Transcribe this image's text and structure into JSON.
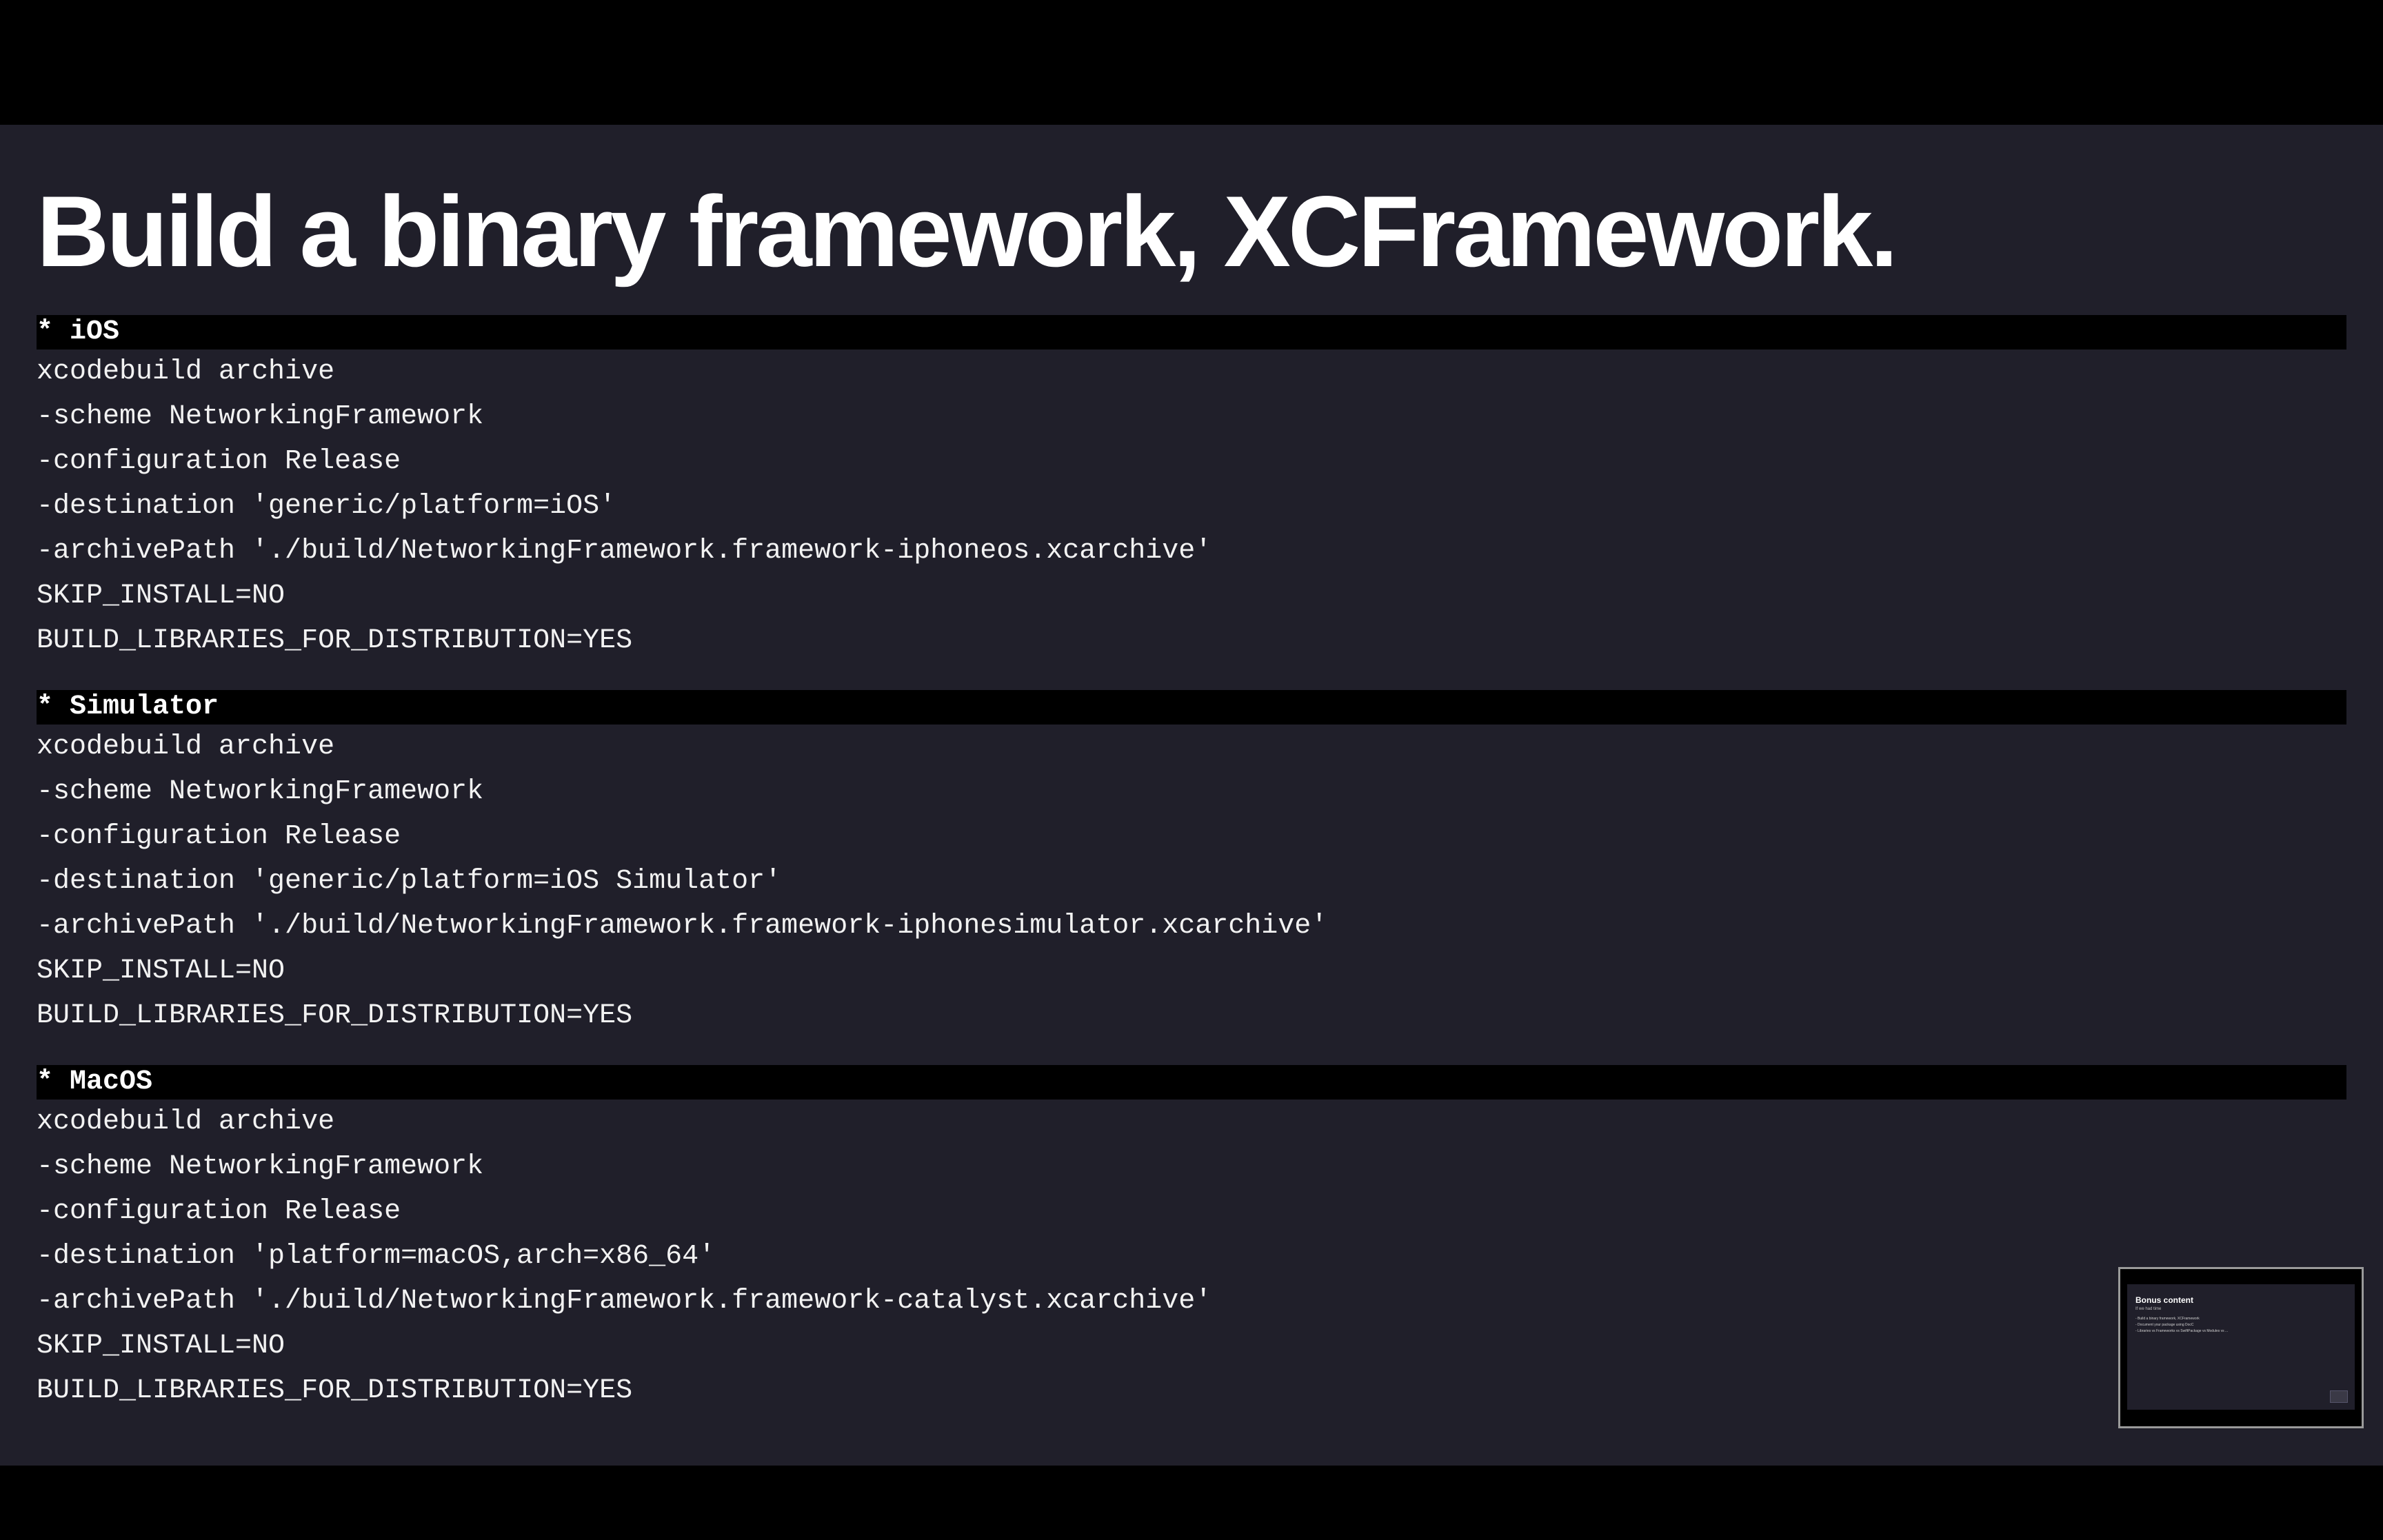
{
  "slide": {
    "title": "Build a binary framework, XCFramework.",
    "sections": [
      {
        "header": "* iOS",
        "lines": [
          "xcodebuild archive",
          "-scheme NetworkingFramework",
          "-configuration Release",
          "-destination 'generic/platform=iOS'",
          "-archivePath './build/NetworkingFramework.framework-iphoneos.xcarchive'",
          "SKIP_INSTALL=NO",
          "BUILD_LIBRARIES_FOR_DISTRIBUTION=YES"
        ]
      },
      {
        "header": "* Simulator",
        "lines": [
          "xcodebuild archive",
          "-scheme NetworkingFramework",
          "-configuration Release",
          "-destination 'generic/platform=iOS Simulator'",
          "-archivePath './build/NetworkingFramework.framework-iphonesimulator.xcarchive'",
          "SKIP_INSTALL=NO",
          "BUILD_LIBRARIES_FOR_DISTRIBUTION=YES"
        ]
      },
      {
        "header": "* MacOS",
        "lines": [
          "xcodebuild archive",
          "-scheme NetworkingFramework",
          "-configuration Release",
          "-destination 'platform=macOS,arch=x86_64'",
          "-archivePath './build/NetworkingFramework.framework-catalyst.xcarchive'",
          "SKIP_INSTALL=NO",
          "BUILD_LIBRARIES_FOR_DISTRIBUTION=YES"
        ]
      }
    ]
  },
  "thumbnail": {
    "title": "Bonus content",
    "subtitle": "If we had time",
    "bullets": [
      "- Build a binary framework, XCFramework",
      "- Document your package using DocC",
      "- Libraries vs Frameworks vs SwiftPackage vs Modules vs ..."
    ]
  },
  "colors": {
    "slide_background": "#201F2A",
    "letterbox": "#000000",
    "text": "#FFFFFF",
    "section_header_background": "#000000"
  }
}
